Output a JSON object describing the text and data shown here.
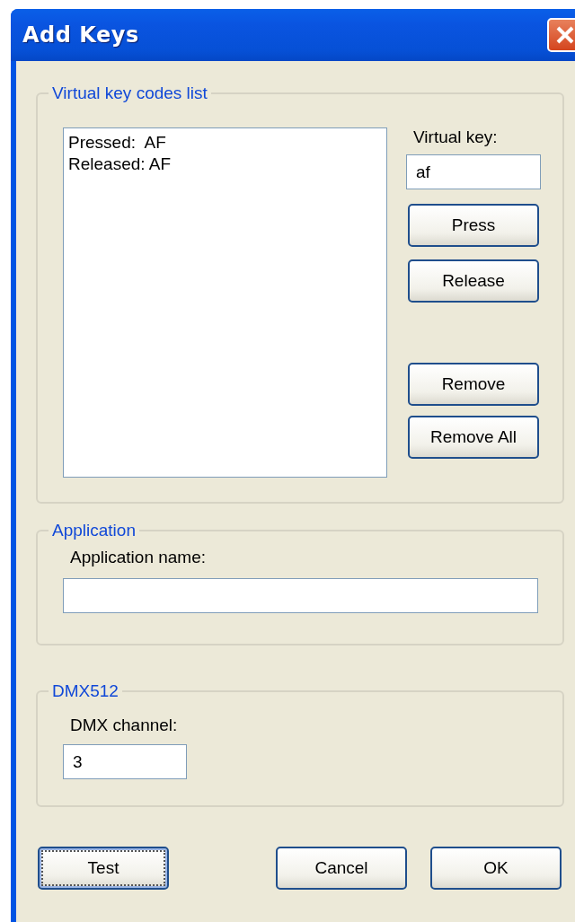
{
  "window": {
    "title": "Add Keys"
  },
  "key_codes_group": {
    "title": "Virtual key codes list",
    "list_items": [
      "Pressed:  AF",
      "Released: AF"
    ],
    "virtual_key_label": "Virtual key:",
    "virtual_key_value": "af",
    "upper_buttons": [
      "Press",
      "Release"
    ],
    "lower_buttons": [
      "Remove",
      "Remove All"
    ]
  },
  "application_group": {
    "title": "Application",
    "name_label": "Application name:"
  },
  "dmx_group": {
    "title": "DMX512",
    "channel_label": "DMX channel:",
    "channel_value": "3"
  },
  "buttons": [
    {
      "label": "Test",
      "focused": true
    },
    {
      "label": "Cancel",
      "focused": false
    },
    {
      "label": "OK",
      "focused": false
    }
  ]
}
